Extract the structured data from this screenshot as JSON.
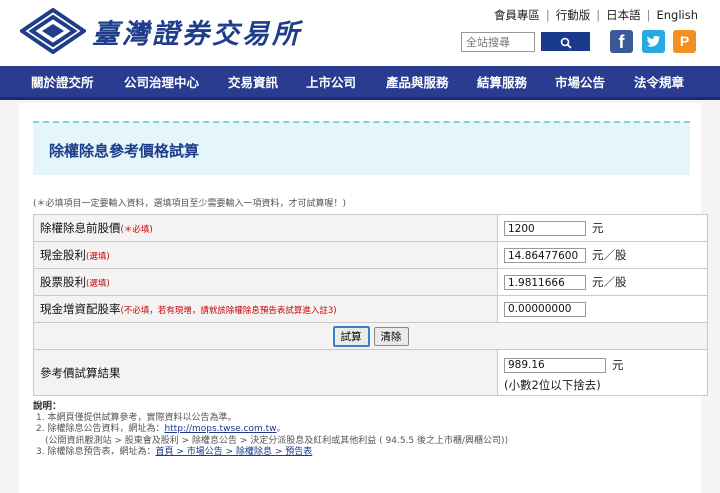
{
  "header": {
    "logo_text": "臺灣證券交易所",
    "links": [
      "會員專區",
      "行動版",
      "日本語",
      "English"
    ],
    "search_placeholder": "全站搜尋",
    "social": {
      "facebook": "f",
      "plurk": "P"
    }
  },
  "nav": {
    "items": [
      "關於證交所",
      "公司治理中心",
      "交易資訊",
      "上市公司",
      "產品與服務",
      "結算服務",
      "市場公告",
      "法令規章"
    ]
  },
  "page": {
    "title": "除權除息參考價格試算",
    "note": "(＊必填項目一定要輸入資料，選填項目至少需要輸入一項資料，才可試算喔！)"
  },
  "form": {
    "rows": [
      {
        "label": "除權除息前股價",
        "tag": "(＊必填)",
        "value": "1200",
        "unit": "元"
      },
      {
        "label": "現金股利",
        "tag": "(選填)",
        "value": "14.86477600",
        "unit": "元／股"
      },
      {
        "label": "股票股利",
        "tag": "(選填)",
        "value": "1.9811666",
        "unit": "元／股"
      },
      {
        "label": "現金增資配股率",
        "tag": "(不必填，若有現增，請就該除權除息預告表試算進入註3)",
        "value": "0.00000000",
        "unit": ""
      }
    ],
    "calc_button": "試算",
    "clear_button": "清除",
    "result_label": "參考價試算結果",
    "result_value": "989.16",
    "result_unit": "元",
    "result_note": "(小數2位以下捨去)"
  },
  "explain": {
    "heading": "說明：",
    "line1": "1. 本網頁僅提供試算參考，實際資料以公告為準。",
    "line2_prefix": "2. 除權除息公告資料，網址為：",
    "line2_link": "http://mops.twse.com.tw",
    "line2_suffix": "。",
    "line2b": "(公開資訊觀測站 > 股東會及股利 > 除權息公告 > 決定分派股息及紅利或其他利益 ( 94.5.5 後之上市櫃/興櫃公司))",
    "line3_prefix": "3. 除權除息預告表，網址為：",
    "line3_link": "首頁 > 市場公告 > 除權除息 > 預告表"
  },
  "colors": {
    "brand": "#1e3d8a",
    "nav": "#2a3c8f",
    "title_band": "#e4f6f9",
    "required": "#cc0000"
  }
}
